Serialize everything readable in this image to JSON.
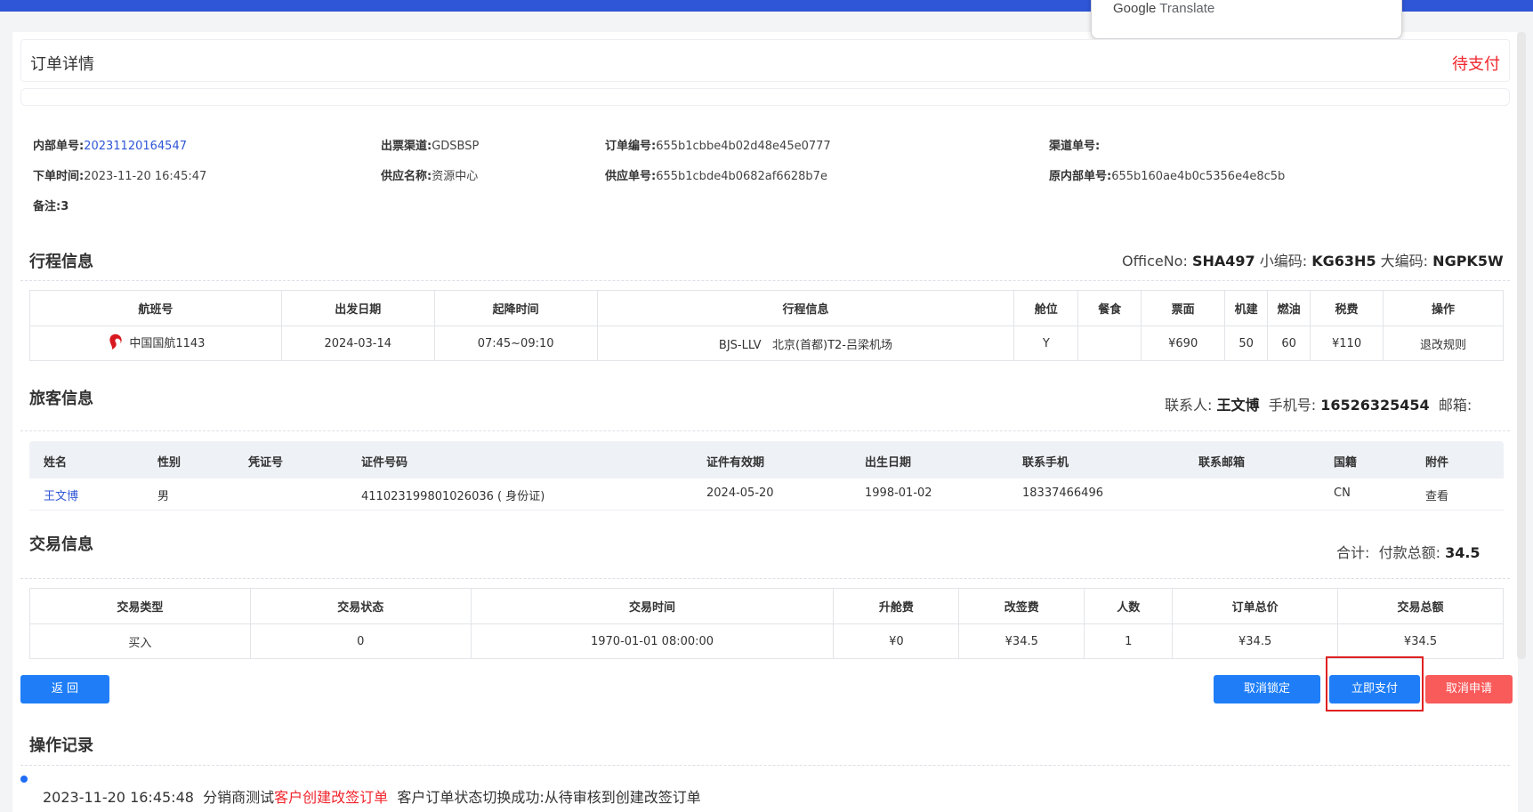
{
  "translate_popup": {
    "brand": "Google",
    "product": "Translate"
  },
  "header": {
    "title": "订单详情",
    "status": "待支付"
  },
  "order_info": {
    "internal_no_label": "内部单号:",
    "internal_no": "20231120164547",
    "channel_label": "出票渠道:",
    "channel": "GDSBSP",
    "order_no_label": "订单编号:",
    "order_no": "655b1cbbe4b02d48e45e0777",
    "channel_no_label": "渠道单号:",
    "channel_no": "",
    "order_time_label": "下单时间:",
    "order_time": "2023-11-20 16:45:47",
    "supplier_label": "供应名称:",
    "supplier": "资源中心",
    "supplier_no_label": "供应单号:",
    "supplier_no": "655b1cbde4b0682af6628b7e",
    "orig_internal_label": "原内部单号:",
    "orig_internal": "655b160ae4b0c5356e4e8c5b",
    "remark_label": "备注:",
    "remark": "3"
  },
  "itinerary": {
    "title": "行程信息",
    "office_label": "OfficeNo:",
    "office": "SHA497",
    "small_code_label": "小编码:",
    "small_code": "KG63H5",
    "big_code_label": "大编码:",
    "big_code": "NGPK5W",
    "columns": [
      "航班号",
      "出发日期",
      "起降时间",
      "行程信息",
      "舱位",
      "餐食",
      "票面",
      "机建",
      "燃油",
      "税费",
      "操作"
    ],
    "rows": [
      {
        "flight": "中国国航1143",
        "date": "2024-03-14",
        "time": "07:45~09:10",
        "route": "BJS-LLV   北京(首都)T2-吕梁机场",
        "cabin": "Y",
        "meal": "",
        "fare": "¥690",
        "airport_fee": "50",
        "fuel": "60",
        "tax": "¥110",
        "action": "退改规则"
      }
    ]
  },
  "passenger": {
    "title": "旅客信息",
    "contact_label": "联系人:",
    "contact": "王文博",
    "phone_label": "手机号:",
    "phone": "16526325454",
    "email_label": "邮箱:",
    "email": "",
    "columns": [
      "姓名",
      "性别",
      "凭证号",
      "证件号码",
      "证件有效期",
      "出生日期",
      "联系手机",
      "联系邮箱",
      "国籍",
      "附件"
    ],
    "rows": [
      {
        "name": "王文博",
        "gender": "男",
        "voucher": "",
        "id_no": "411023199801026036 ( 身份证)",
        "id_expiry": "2024-05-20",
        "birth": "1998-01-02",
        "mobile": "18337466496",
        "email": "",
        "nationality": "CN",
        "attachment": "查看"
      }
    ]
  },
  "transaction": {
    "title": "交易信息",
    "total_label": "合计:",
    "paid_label": "付款总额:",
    "paid": "34.5",
    "columns": [
      "交易类型",
      "交易状态",
      "交易时间",
      "升舱费",
      "改签费",
      "人数",
      "订单总价",
      "交易总额"
    ],
    "rows": [
      {
        "type": "买入",
        "status": "0",
        "time": "1970-01-01 08:00:00",
        "upgrade": "¥0",
        "change_fee": "¥34.5",
        "count": "1",
        "order_total": "¥34.5",
        "trade_total": "¥34.5"
      }
    ]
  },
  "buttons": {
    "back": "返 回",
    "cancel_lock": "取消锁定",
    "pay_now": "立即支付",
    "cancel_apply": "取消申请"
  },
  "log": {
    "title": "操作记录",
    "entries": [
      {
        "time": "2023-11-20 16:45:48",
        "actor": "分销商测试",
        "action": "客户创建改签订单",
        "message": "客户订单状态切换成功:从待审核到创建改签订单"
      }
    ]
  },
  "colors": {
    "primary": "#1f7ef7",
    "danger": "#f95a5a",
    "status_red": "#f0262d",
    "topbar": "#2f56d6"
  }
}
